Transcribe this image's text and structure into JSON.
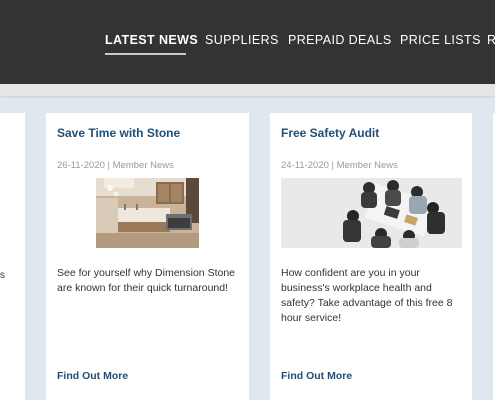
{
  "nav": {
    "items": [
      {
        "label": "LATEST NEWS",
        "active": true
      },
      {
        "label": "SUPPLIERS",
        "active": false
      },
      {
        "label": "PREPAID DEALS",
        "active": false
      },
      {
        "label": "PRICE LISTS",
        "active": false
      },
      {
        "label": "R",
        "active": false
      }
    ]
  },
  "cards": [
    {
      "title": "Save Time with Stone",
      "meta": "26-11-2020 | Member News",
      "image": "kitchen-photo",
      "body": "See for yourself why Dimension Stone are known for their quick turnaround!",
      "link": "Find Out More"
    },
    {
      "title": "Free Safety Audit",
      "meta": "24-11-2020 | Member News",
      "image": "meeting-photo",
      "body": "How confident are you in your business's workplace health and safety? Take advantage of this free 8 hour service!",
      "link": "Find Out More"
    }
  ],
  "left_card": {
    "fragment": "s"
  },
  "colors": {
    "nav_bg": "#333333",
    "title": "#1f4f77",
    "page_bg": "#dfe8ee"
  }
}
